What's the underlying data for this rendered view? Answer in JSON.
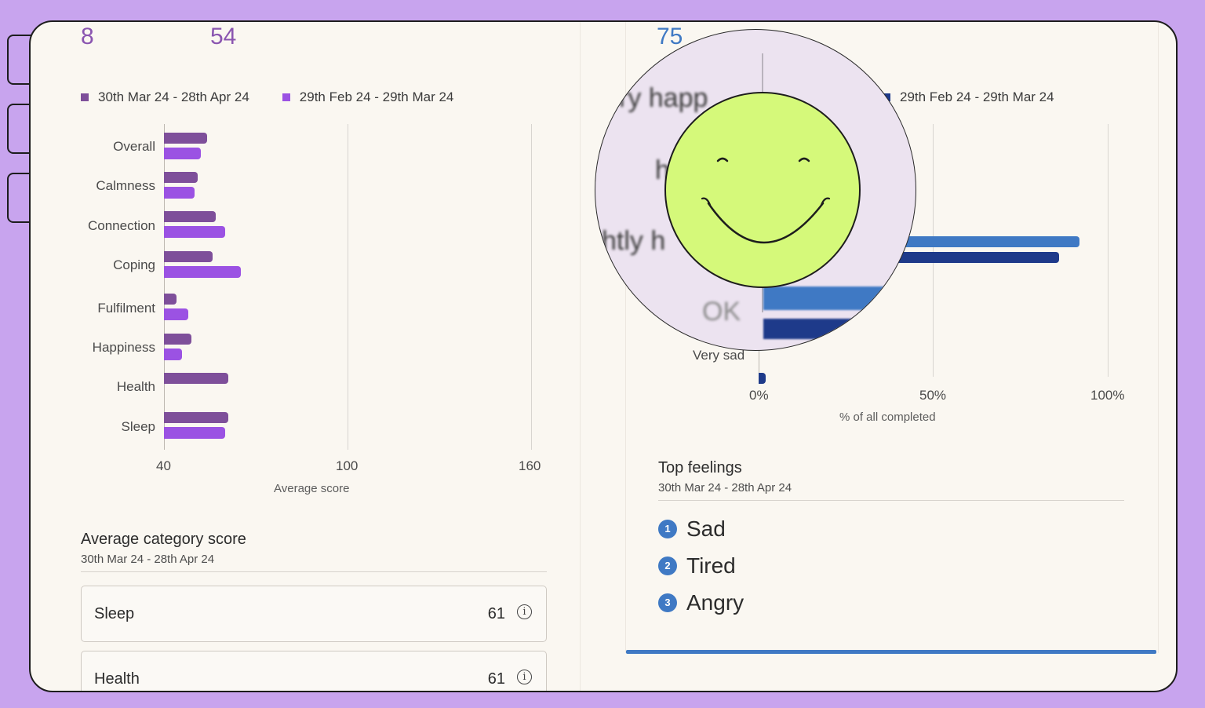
{
  "header": {
    "left_stat_1": "8",
    "left_stat_2": "54",
    "right_stat": "75"
  },
  "colors": {
    "period_current": "#7e4f9a",
    "period_previous": "#9b52e3",
    "right_current": "#3f79c4",
    "right_previous": "#1e3a8a",
    "accent_blue": "#3f79c4",
    "smiley_green": "#d5f97a"
  },
  "left_chart": {
    "legend": [
      {
        "label": "30th Mar 24 - 28th Apr 24",
        "color": "#7e4f9a"
      },
      {
        "label": "29th Feb 24 - 29th Mar 24",
        "color": "#9b52e3"
      }
    ],
    "axis_title": "Average score",
    "ticks": [
      "40",
      "100",
      "160"
    ]
  },
  "right_chart": {
    "legend_partial": "29th Feb 24 - 29th Mar 24",
    "magnified_labels": [
      "ry happ",
      "h",
      "htly h",
      "OK"
    ],
    "visible_label": "Very sad",
    "axis_title": "% of all completed",
    "ticks": [
      "0%",
      "50%",
      "100%"
    ]
  },
  "chart_data": [
    {
      "type": "bar",
      "orientation": "horizontal",
      "categories": [
        "Overall",
        "Calmness",
        "Connection",
        "Coping",
        "Fulfilment",
        "Happiness",
        "Health",
        "Sleep"
      ],
      "series": [
        {
          "name": "30th Mar 24 - 28th Apr 24",
          "values": [
            54,
            51,
            57,
            56,
            44,
            49,
            61,
            61
          ]
        },
        {
          "name": "29th Feb 24 - 29th Mar 24",
          "values": [
            52,
            50,
            60,
            65,
            48,
            46,
            null,
            60
          ]
        }
      ],
      "xlabel": "Average score",
      "xlim": [
        40,
        160
      ],
      "grid": true
    },
    {
      "type": "bar",
      "orientation": "horizontal",
      "categories": [
        "Very happy",
        "Happy",
        "Slightly happy",
        "OK",
        "Very sad"
      ],
      "series": [
        {
          "values": [
            null,
            null,
            92,
            60,
            0
          ]
        },
        {
          "name": "29th Feb 24 - 29th Mar 24",
          "values": [
            null,
            null,
            86,
            50,
            2
          ]
        }
      ],
      "xlabel": "% of all completed",
      "xlim": [
        0,
        100
      ],
      "grid": true
    }
  ],
  "average_category": {
    "title": "Average category score",
    "subtitle": "30th Mar 24 - 28th Apr 24",
    "rows": [
      {
        "name": "Sleep",
        "score": "61"
      },
      {
        "name": "Health",
        "score": "61"
      }
    ],
    "info_glyph": "i"
  },
  "top_feelings": {
    "title": "Top feelings",
    "subtitle": "30th Mar 24 - 28th Apr 24",
    "items": [
      {
        "rank": "1",
        "label": "Sad"
      },
      {
        "rank": "2",
        "label": "Tired"
      },
      {
        "rank": "3",
        "label": "Angry"
      }
    ]
  },
  "icons": [
    "info-icon",
    "smiley-face-icon",
    "magnifier-lens"
  ]
}
